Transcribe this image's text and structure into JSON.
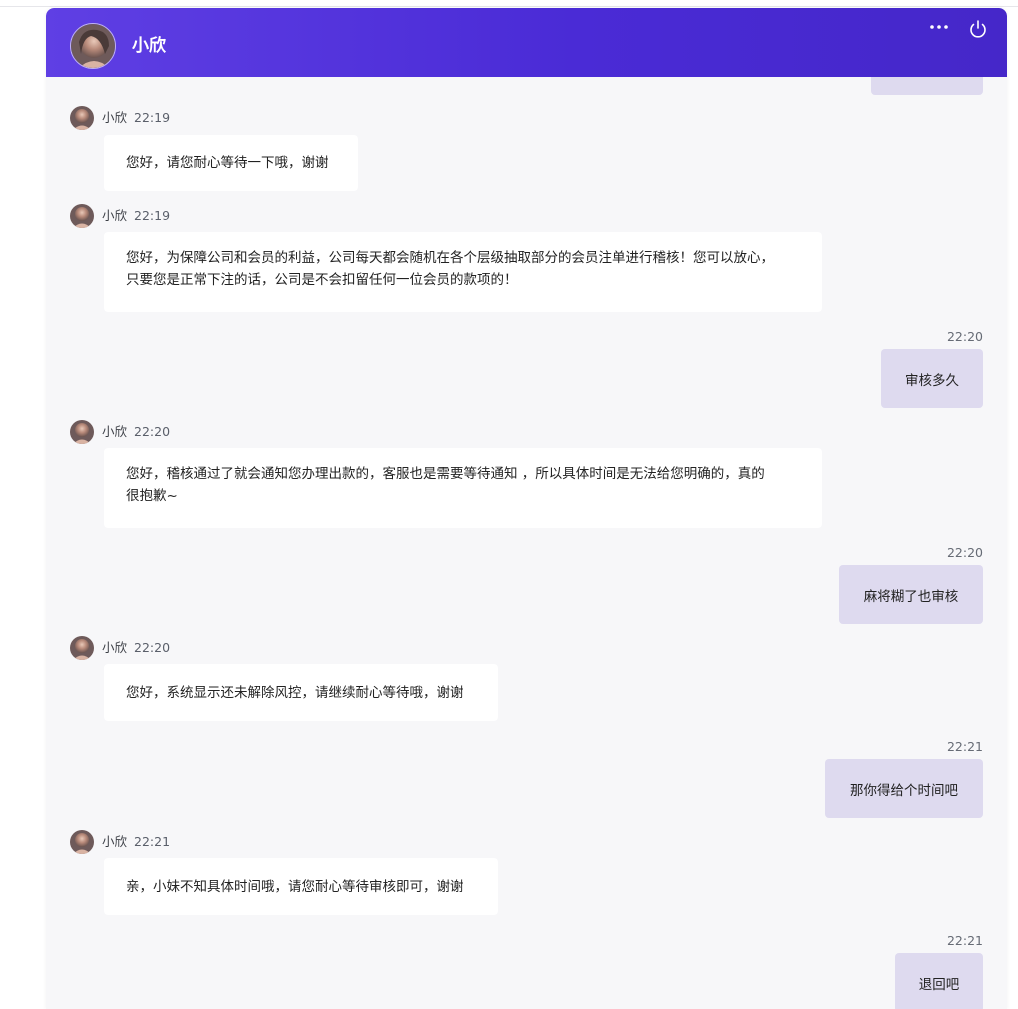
{
  "header": {
    "agent_name": "小欣"
  },
  "icons": {
    "more": "more-horizontal-icon",
    "power": "power-icon"
  },
  "colors": {
    "header_gradient_start": "#5f3fe4",
    "header_gradient_end": "#4527c9",
    "my_bubble": "#dedaef",
    "agent_bubble": "#ffffff",
    "background": "#f7f7f9"
  },
  "messages": [
    {
      "from": "agent",
      "sender": "小欣",
      "time": "22:19",
      "text": "您好，请您耐心等待一下哦，谢谢"
    },
    {
      "from": "agent",
      "sender": "小欣",
      "time": "22:19",
      "line1": "您好，为保障公司和会员的利益，公司每天都会随机在各个层级抽取部分的会员注单进行稽核！您可以放心，",
      "line2": "只要您是正常下注的话，公司是不会扣留任何一位会员的款项的！"
    },
    {
      "from": "me",
      "time": "22:20",
      "text": "审核多久"
    },
    {
      "from": "agent",
      "sender": "小欣",
      "time": "22:20",
      "line1": "您好，稽核通过了就会通知您办理出款的，客服也是需要等待通知 ，所以具体时间是无法给您明确的，真的",
      "line2": "很抱歉~"
    },
    {
      "from": "me",
      "time": "22:20",
      "text": "麻将糊了也审核"
    },
    {
      "from": "agent",
      "sender": "小欣",
      "time": "22:20",
      "text": "您好，系统显示还未解除风控，请继续耐心等待哦，谢谢"
    },
    {
      "from": "me",
      "time": "22:21",
      "text": "那你得给个时间吧"
    },
    {
      "from": "agent",
      "sender": "小欣",
      "time": "22:21",
      "text": "亲，小妹不知具体时间哦，请您耐心等待审核即可，谢谢"
    },
    {
      "from": "me",
      "time": "22:21",
      "text": "退回吧"
    }
  ]
}
